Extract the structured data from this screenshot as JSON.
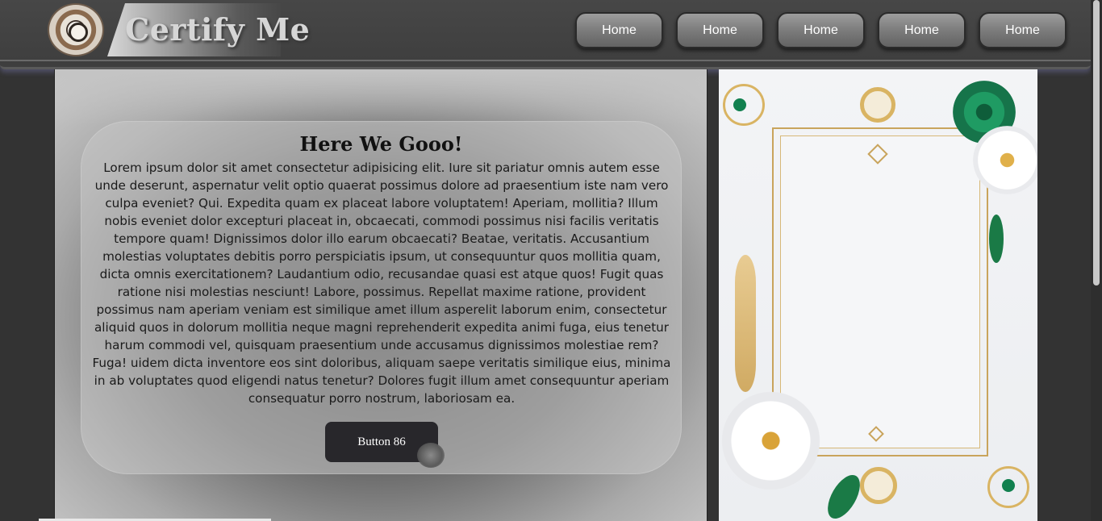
{
  "header": {
    "brand": "Certify Me",
    "nav": [
      "Home",
      "Home",
      "Home",
      "Home",
      "Home"
    ]
  },
  "card": {
    "title": "Here We Gooo!",
    "body": "Lorem ipsum dolor sit amet consectetur adipisicing elit. Iure sit pariatur omnis autem esse unde deserunt, aspernatur velit optio quaerat possimus dolore ad praesentium iste nam vero culpa eveniet? Qui. Expedita quam ex placeat labore voluptatem! Aperiam, mollitia? Illum nobis eveniet dolor excepturi placeat in, obcaecati, commodi possimus nisi facilis veritatis tempore quam! Dignissimos dolor illo earum obcaecati? Beatae, veritatis. Accusantium molestias voluptates debitis porro perspiciatis ipsum, ut consequuntur quos mollitia quam, dicta omnis exercitationem? Laudantium odio, recusandae quasi est atque quos! Fugit quas ratione nisi molestias nesciunt! Labore, possimus. Repellat maxime ratione, provident possimus nam aperiam veniam est similique amet illum asperelit laborum enim, consectetur aliquid quos in dolorum mollitia neque magni reprehenderit expedita animi fuga, eius tenetur harum commodi vel, quisquam praesentium unde accusamus dignissimos molestiae rem? Fuga! uidem dicta inventore eos sint doloribus, aliquam saepe veritatis similique eius, minima in ab voluptates quod eligendi natus tenetur? Dolores fugit illum amet consequuntur aperiam consequatur porro nostrum, laboriosam ea.",
    "button": "Button 86"
  },
  "icons": {
    "logo": "clock-logo-icon",
    "frame": "floral-certificate-frame"
  }
}
